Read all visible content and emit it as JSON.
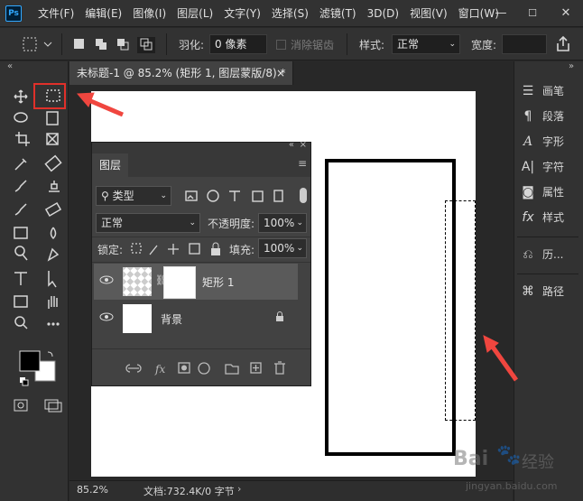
{
  "menubar": {
    "logo": "Ps",
    "items": [
      "文件(F)",
      "编辑(E)",
      "图像(I)",
      "图层(L)",
      "文字(Y)",
      "选择(S)",
      "滤镜(T)",
      "3D(D)",
      "视图(V)",
      "窗口(W)"
    ],
    "controls": {
      "minimize": "—",
      "maximize": "☐",
      "close": "✕"
    }
  },
  "options": {
    "feather_label": "羽化:",
    "feather_value": "0 像素",
    "antialias_label": "消除锯齿",
    "style_label": "样式:",
    "style_value": "正常",
    "width_label": "宽度:"
  },
  "document": {
    "tab_title": "未标题-1 @ 85.2% (矩形 1, 图层蒙版/8) *",
    "tab_close": "×",
    "zoom": "85.2%",
    "doc_info": "文档:732.4K/0 字节"
  },
  "right_panel": {
    "items": [
      {
        "label": "画笔",
        "icon": "brush-icon"
      },
      {
        "label": "段落",
        "icon": "paragraph-icon"
      },
      {
        "label": "字形",
        "icon": "glyphs-icon"
      },
      {
        "label": "字符",
        "icon": "character-icon"
      },
      {
        "label": "属性",
        "icon": "properties-icon"
      },
      {
        "label": "样式",
        "icon": "styles-icon"
      },
      {
        "label": "历...",
        "icon": "history-icon"
      },
      {
        "label": "路径",
        "icon": "paths-icon"
      }
    ]
  },
  "layers": {
    "tab": "图层",
    "filter_kind": "类型",
    "blend_mode": "正常",
    "opacity_label": "不透明度:",
    "opacity_value": "100%",
    "lock_label": "锁定:",
    "fill_label": "填充:",
    "fill_value": "100%",
    "rows": [
      {
        "name": "矩形 1",
        "selected": true
      },
      {
        "name": "背景",
        "selected": false
      }
    ]
  },
  "watermark": {
    "brand": "Bai",
    "brand2": "经验",
    "url": "jingyan.baidu.com"
  }
}
